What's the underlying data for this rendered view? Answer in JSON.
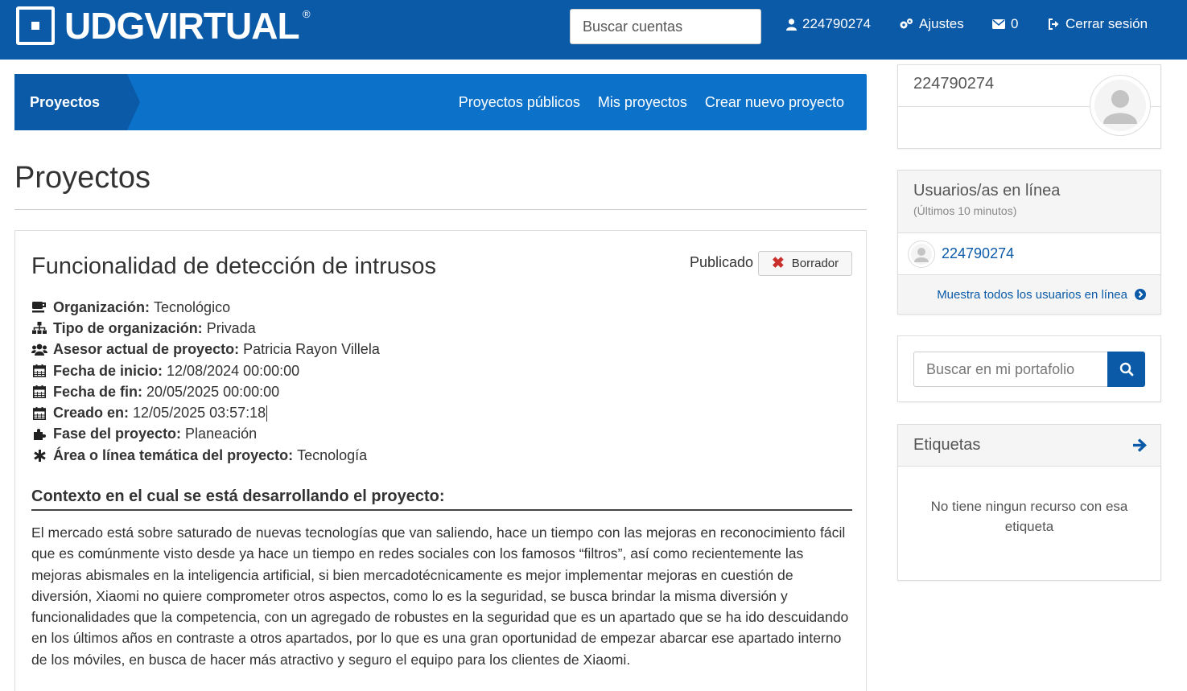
{
  "header": {
    "logo_text": "UDGVIRTUAL",
    "logo_reg": "®",
    "search_placeholder": "Buscar cuentas",
    "user_id": "224790274",
    "settings_label": "Ajustes",
    "messages_count": "0",
    "logout_label": "Cerrar sesión"
  },
  "projnav": {
    "brand": "Proyectos",
    "links": [
      "Proyectos públicos",
      "Mis proyectos",
      "Crear nuevo proyecto"
    ]
  },
  "page_title": "Proyectos",
  "project": {
    "title": "Funcionalidad de detección de intrusos",
    "status_label": "Publicado",
    "draft_label": "Borrador",
    "meta": [
      {
        "icon": "coffee-icon",
        "label": "Organización:",
        "value": "Tecnológico"
      },
      {
        "icon": "sitemap-icon",
        "label": "Tipo de organización:",
        "value": "Privada"
      },
      {
        "icon": "users-icon",
        "label": "Asesor actual de proyecto:",
        "value": "Patricia Rayon Villela"
      },
      {
        "icon": "calendar-icon",
        "label": "Fecha de inicio:",
        "value": "12/08/2024 00:00:00"
      },
      {
        "icon": "calendar-icon",
        "label": "Fecha de fin:",
        "value": "20/05/2025 00:00:00"
      },
      {
        "icon": "calendar-icon",
        "label": "Creado en:",
        "value": "12/05/2025 03:57:18"
      },
      {
        "icon": "puzzle-icon",
        "label": "Fase del proyecto:",
        "value": "Planeación"
      },
      {
        "icon": "asterisk-icon",
        "label": "Área o línea temática del proyecto:",
        "value": "Tecnología"
      }
    ],
    "context_title": "Contexto en el cual se está desarrollando el proyecto:",
    "context_body": "El mercado está sobre saturado de nuevas tecnologías que van saliendo, hace un tiempo con las mejoras en reconocimiento fácil que es comúnmente visto desde ya hace un tiempo en redes sociales con los famosos “filtros”, así como recientemente las mejoras abismales en la inteligencia artificial, si  bien mercadotécnicamente es mejor implementar mejoras en cuestión de diversión, Xiaomi no quiere comprometer otros aspectos, como lo es la seguridad, se busca brindar la misma diversión y funcionalidades que la competencia, con un agregado de robustes en la seguridad que es un apartado que se ha ido descuidando en los últimos años en contraste a otros apartados, por lo que es una gran oportunidad de empezar abarcar ese apartado interno de los móviles, en busca de hacer más atractivo y seguro el equipo para los clientes de Xiaomi."
  },
  "sidebar": {
    "profile_name": "224790274",
    "online_title": "Usuarios/as en línea",
    "online_subtitle": "(Últimos 10 minutos)",
    "online_user": "224790274",
    "show_all_label": "Muestra todos los usuarios en línea",
    "portfolio_placeholder": "Buscar en mi portafolio",
    "tags_title": "Etiquetas",
    "tags_empty": "No tiene ningun recurso con esa etiqueta"
  },
  "colors": {
    "brand_dark": "#0a5aa8",
    "brand_light": "#0c72c9",
    "danger": "#c9302c"
  }
}
